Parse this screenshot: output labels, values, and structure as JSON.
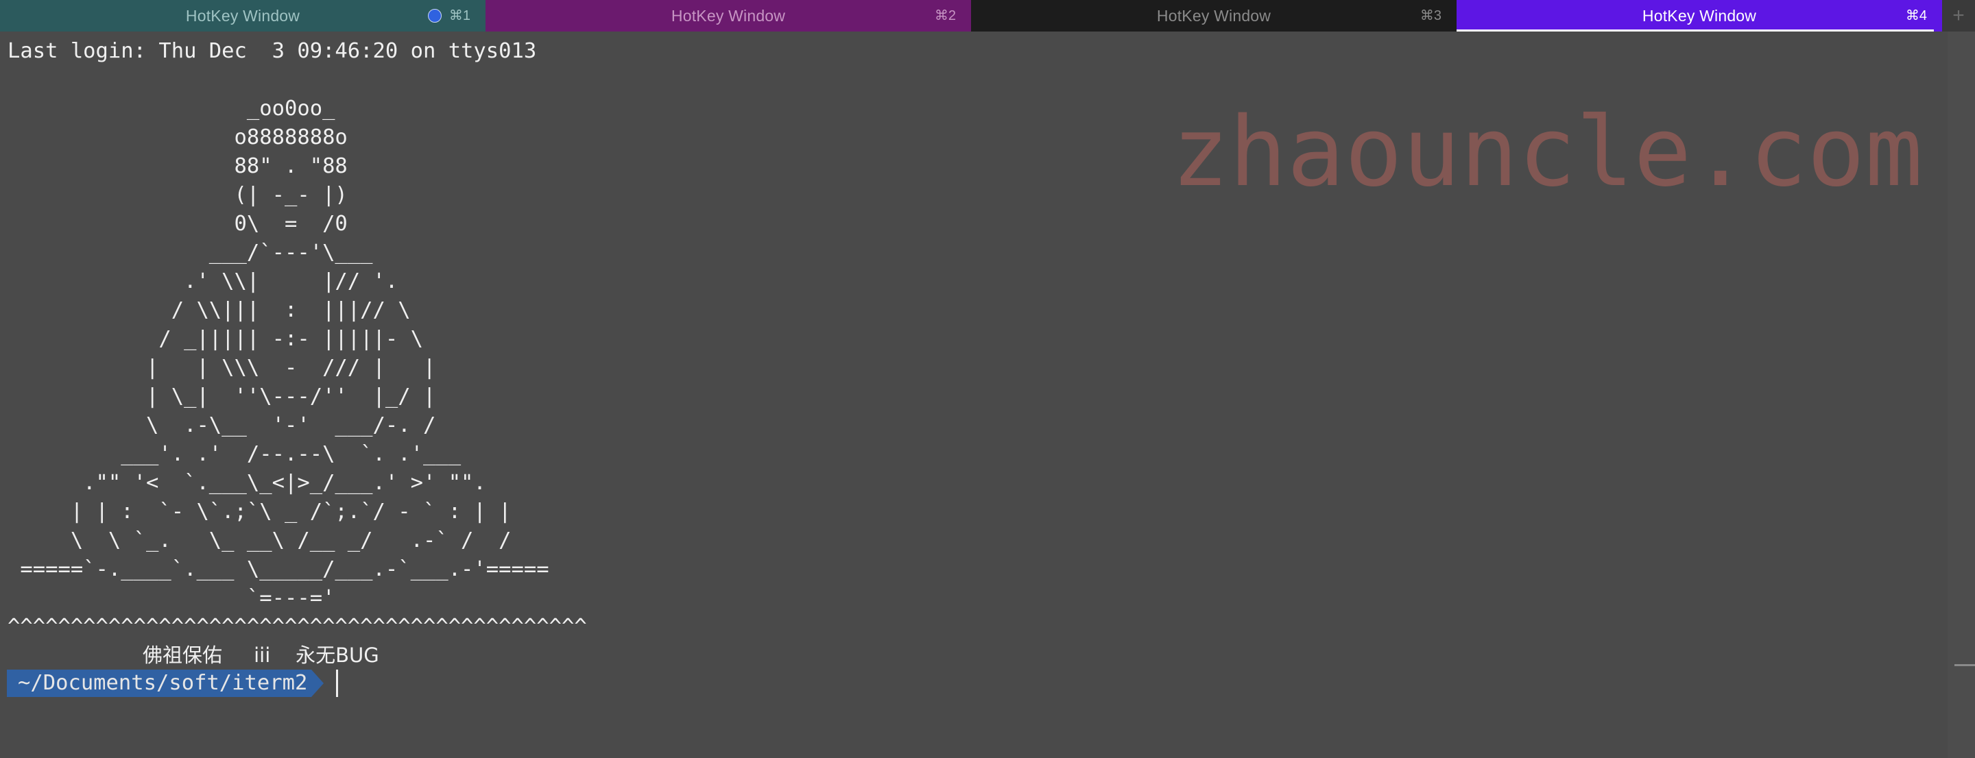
{
  "tabs": [
    {
      "title": "HotKey Window",
      "shortcut": "⌘1",
      "has_activity_dot": true
    },
    {
      "title": "HotKey Window",
      "shortcut": "⌘2"
    },
    {
      "title": "HotKey Window",
      "shortcut": "⌘3"
    },
    {
      "title": "HotKey Window",
      "shortcut": "⌘4",
      "active": true
    }
  ],
  "new_tab_label": "+",
  "watermark": "zhaouncle.com",
  "terminal": {
    "last_login": "Last login: Thu Dec  3 09:46:20 on ttys013",
    "art": [
      "                   _oo0oo_",
      "                  o8888888o",
      "                  88\" . \"88",
      "                  (| -_- |)",
      "                  0\\  =  /0",
      "                ___/`---'\\___",
      "              .' \\\\|     |// '.",
      "             / \\\\|||  :  |||// \\",
      "            / _||||| -:- |||||- \\",
      "           |   | \\\\\\  -  /// |   |",
      "           | \\_|  ''\\---/''  |_/ |",
      "           \\  .-\\__  '-'  ___/-. /",
      "         ___'. .'  /--.--\\  `. .'___",
      "      .\"\" '<  `.___\\_<|>_/___.' >' \"\".",
      "     | | :  `- \\`.;`\\ _ /`;.`/ - ` : | |",
      "     \\  \\ `_.   \\_ __\\ /__ _/   .-` /  /",
      " =====`-.____`.___ \\_____/___.-`___.-'=====",
      "                   `=---='",
      "^^^^^^^^^^^^^^^^^^^^^^^^^^^^^^^^^^^^^^^^^^^^^^"
    ],
    "blessing": "佛祖保佑     iii    永无BUG",
    "prompt_path": "~/Documents/soft/iterm2"
  }
}
